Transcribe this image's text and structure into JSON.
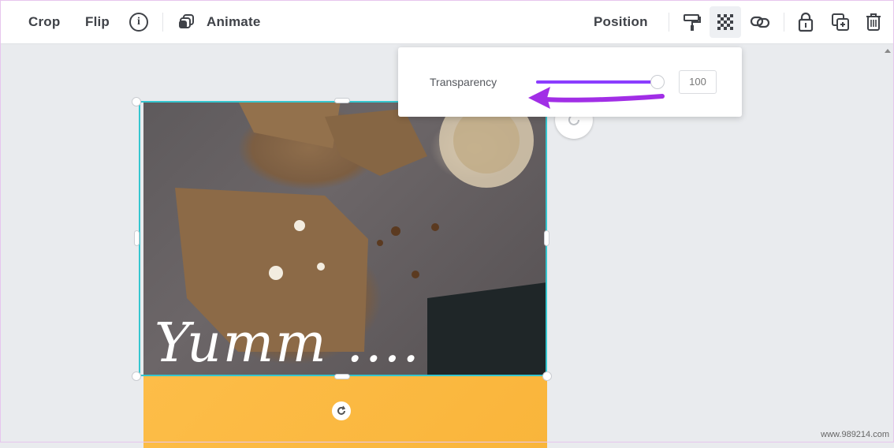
{
  "toolbar": {
    "crop_label": "Crop",
    "flip_label": "Flip",
    "info_icon": "info-icon",
    "info_glyph": "i",
    "animate_label": "Animate",
    "position_label": "Position"
  },
  "transparency_popup": {
    "label": "Transparency",
    "value": "100",
    "slider_level_fraction": 1.0
  },
  "canvas": {
    "overlay_text": "Yumm ....",
    "band_color": "#fbb942",
    "selection_color": "#35c6cf"
  },
  "annotation": {
    "arrow_color": "#a12ee6"
  },
  "watermark": "www.989214.com"
}
